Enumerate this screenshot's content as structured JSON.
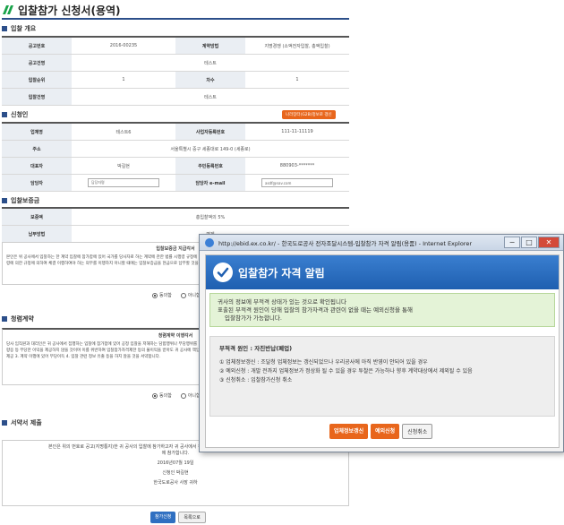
{
  "page": {
    "title": "입찰참가 신청서(용역)"
  },
  "overview": {
    "heading": "입찰 개요",
    "rows": [
      {
        "l1": "공고번호",
        "v1": "2016-00235",
        "l2": "계약방법",
        "v2": "지명경쟁 (소액전자입찰, 총액입찰)"
      },
      {
        "l1": "공고건명",
        "v1": "테스트"
      },
      {
        "l1": "입찰순위",
        "v1": "1",
        "l2": "차수",
        "v2": "1"
      },
      {
        "l1": "입찰건명",
        "v1": "테스트"
      }
    ]
  },
  "applicant": {
    "heading": "신청인",
    "button": "나라장터(G2B)정보로 갱신",
    "rows": [
      {
        "l1": "업체명",
        "v1": "테스트6",
        "l2": "사업자등록번호",
        "v2": "111-11-11119"
      },
      {
        "l1": "주소",
        "v1": "서울특별시 중구 세종대로 149-0 (세종로)"
      },
      {
        "l1": "대표자",
        "v1": "박길현",
        "l2": "주민등록번호",
        "v2": "880903-*******"
      },
      {
        "l1": "담당자",
        "v1": "담당자명",
        "l2": "담당자 e-mail",
        "v2": "asdf@nav.com"
      }
    ]
  },
  "deposit": {
    "heading": "입찰보증금",
    "rows": [
      {
        "l1": "보증액",
        "v1": "총입찰액의 5%"
      },
      {
        "l1": "납부방법",
        "v1": "면제"
      }
    ],
    "terms_title": "입찰보증금 지급각서",
    "terms_text": "본인은 위 공사에서 입찰하는 한 계약 입찰에 참가함에 있어 국가를 당사자로 하는 계약에 관한 법률 시행령 규정에 의한 입찰보증금의 납부를 면제 받았으며 낙찰 후 계약을 체결하지 아니하거나 관계 법령에 의한 규정에 의하여 체결 이행하여야 하는 의무를 이행하지 아니할 때에는 입찰보증금을 현금으로 납부할 것을 각서합니다.",
    "agree": "동의함",
    "disagree": "아니함"
  },
  "clean": {
    "heading": "청렴계약",
    "terms_title": "청렴계약 이행각서",
    "terms_text": "당사 임직원과 대리인은 귀 공사에서 집행하는 입찰에 참가함에 있어 공정 입찰을 저해하는 담합행위나 부당행위를 하지 않을 것이며 입찰 및 계약 과정에서 공사 임직원에게 직접 또는 간접적으로 금품, 향응 등 부당한 이익을 제공하지 않을 것이며 이를 위반하여 입찰참가자격제한 등의 불이익을 받아도 귀 공사에 책임을 묻지 않겠습니다. 1. 경쟁입찰과 관련한 담합행위 2. 입찰 및 계약 과정에서의 금품 제공 3. 계약 이행에 있어 부당이득 4. 입찰 관련 정보 유출 등을 하지 않을 것을 서약합니다.",
    "agree": "동의함",
    "disagree": "아니함"
  },
  "pledge": {
    "heading": "서약서 제출",
    "lines": [
      "본인은 위의 번호로 공고(지명통지)한 귀 공사의 입찰에 참가하고자 귀 공사에서 정한 입찰유의서 및 입찰공고 사항을 모두 승낙하고 입찰에 참가합니다.",
      "2016년07월 19일",
      "신청인 박길현",
      "한국도로공사 사장 귀하"
    ]
  },
  "bottom_buttons": {
    "submit": "참가신청",
    "list": "목록으로"
  },
  "popup": {
    "url": "http://ebid.ex.co.kr/ - 한국도로공사 전자조달시스템-입찰참가 자격 알림(용품) - Internet Explorer",
    "title": "입찰참가 자격 알림",
    "notice_lines": [
      "귀사의 정보에 부적격 상태가 있는 것으로 확인됩니다",
      "표출된 부적격 원인이 당해 입찰의 참가자격과 관련이 없을 때는 예외신청을 통해",
      "입찰참가가 가능합니다."
    ],
    "reason_title": "부적격 원인 : 자진반납(폐업)",
    "reason_lines": [
      "① 업체정보갱신 : 조달청 업체정보는 갱신되었으나 우리공사에 아직 반영이 안되어 있을 경우",
      "② 예외신청 : 개발 전까지 업체정보가 정상화 될 수 있을 경우 투찰은 가능하나 향후 계약대상에서 제외될 수 있음",
      "③ 신청취소 : 입찰참가신청 취소"
    ],
    "buttons": {
      "update": "업체정보갱신",
      "exception": "예외신청",
      "cancel": "신청취소"
    }
  },
  "colors": {
    "accent": "#2c4f8a",
    "orange": "#e8661c",
    "blue": "#2f6fc1"
  }
}
